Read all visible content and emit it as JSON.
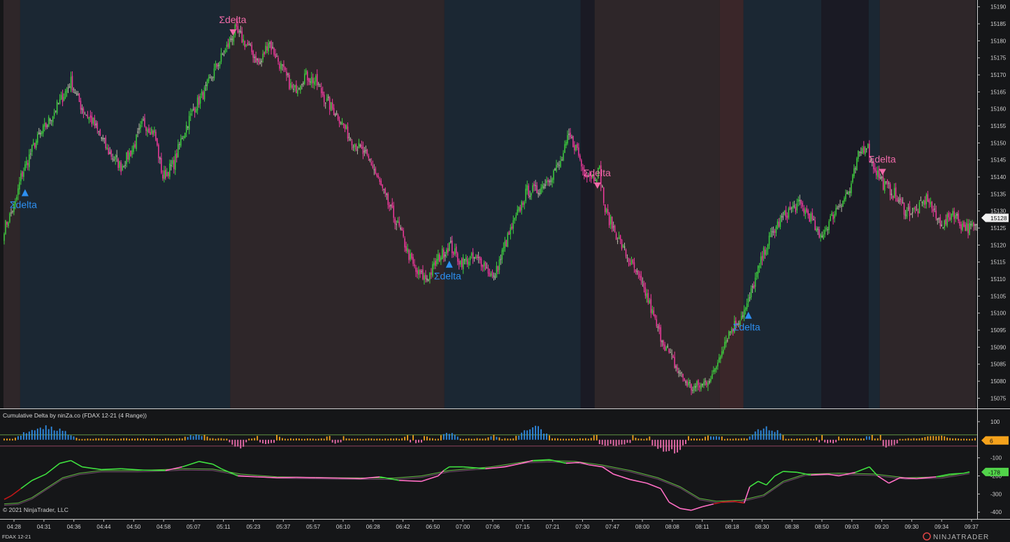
{
  "chart_data": [
    {
      "type": "candlestick",
      "panel": "price",
      "instrument": "FDAX 12-21",
      "ylim": [
        15072,
        15192
      ],
      "y_ticks": [
        15075,
        15080,
        15085,
        15090,
        15095,
        15100,
        15105,
        15110,
        15115,
        15120,
        15125,
        15130,
        15135,
        15140,
        15145,
        15150,
        15155,
        15160,
        15165,
        15170,
        15175,
        15180,
        15185,
        15190
      ],
      "last_price": "15128",
      "colors": {
        "up": "#3ecf3e",
        "down": "#ee3a9c",
        "neutral": "#b6b6a4"
      },
      "close_path": [
        [
          0,
          15125
        ],
        [
          8,
          15132
        ],
        [
          12,
          15140
        ],
        [
          22,
          15150
        ],
        [
          30,
          15155
        ],
        [
          40,
          15162
        ],
        [
          48,
          15168
        ],
        [
          56,
          15160
        ],
        [
          64,
          15156
        ],
        [
          74,
          15148
        ],
        [
          84,
          15143
        ],
        [
          92,
          15148
        ],
        [
          100,
          15156
        ],
        [
          108,
          15153
        ],
        [
          114,
          15140
        ],
        [
          122,
          15144
        ],
        [
          128,
          15152
        ],
        [
          136,
          15160
        ],
        [
          144,
          15165
        ],
        [
          152,
          15172
        ],
        [
          160,
          15178
        ],
        [
          166,
          15183
        ],
        [
          172,
          15180
        ],
        [
          176,
          15178
        ],
        [
          184,
          15173
        ],
        [
          190,
          15180
        ],
        [
          196,
          15175
        ],
        [
          202,
          15170
        ],
        [
          208,
          15165
        ],
        [
          216,
          15170
        ],
        [
          224,
          15168
        ],
        [
          232,
          15162
        ],
        [
          240,
          15158
        ],
        [
          248,
          15152
        ],
        [
          256,
          15148
        ],
        [
          264,
          15144
        ],
        [
          270,
          15138
        ],
        [
          276,
          15132
        ],
        [
          284,
          15125
        ],
        [
          290,
          15118
        ],
        [
          296,
          15112
        ],
        [
          304,
          15110
        ],
        [
          312,
          15116
        ],
        [
          320,
          15120
        ],
        [
          328,
          15115
        ],
        [
          336,
          15116
        ],
        [
          344,
          15115
        ],
        [
          352,
          15110
        ],
        [
          360,
          15120
        ],
        [
          368,
          15128
        ],
        [
          376,
          15136
        ],
        [
          384,
          15136
        ],
        [
          392,
          15140
        ],
        [
          400,
          15144
        ],
        [
          406,
          15152
        ],
        [
          412,
          15148
        ],
        [
          416,
          15142
        ],
        [
          424,
          15140
        ],
        [
          428,
          15142
        ],
        [
          432,
          15130
        ],
        [
          438,
          15125
        ],
        [
          446,
          15118
        ],
        [
          454,
          15112
        ],
        [
          462,
          15105
        ],
        [
          470,
          15095
        ],
        [
          478,
          15088
        ],
        [
          486,
          15082
        ],
        [
          494,
          15078
        ],
        [
          502,
          15079
        ],
        [
          510,
          15082
        ],
        [
          516,
          15090
        ],
        [
          522,
          15095
        ],
        [
          528,
          15098
        ],
        [
          534,
          15102
        ],
        [
          540,
          15110
        ],
        [
          548,
          15120
        ],
        [
          556,
          15126
        ],
        [
          564,
          15130
        ],
        [
          572,
          15132
        ],
        [
          580,
          15128
        ],
        [
          586,
          15122
        ],
        [
          592,
          15126
        ],
        [
          600,
          15132
        ],
        [
          608,
          15136
        ],
        [
          614,
          15146
        ],
        [
          620,
          15150
        ],
        [
          624,
          15144
        ],
        [
          632,
          15138
        ],
        [
          640,
          15135
        ],
        [
          648,
          15130
        ],
        [
          656,
          15130
        ],
        [
          664,
          15134
        ],
        [
          670,
          15128
        ],
        [
          676,
          15126
        ],
        [
          682,
          15130
        ],
        [
          688,
          15126
        ],
        [
          694,
          15125
        ]
      ],
      "regions": [
        {
          "from": 0,
          "to": 12,
          "tone": "bear"
        },
        {
          "from": 12,
          "to": 163,
          "tone": "bull"
        },
        {
          "from": 163,
          "to": 317,
          "tone": "bear"
        },
        {
          "from": 317,
          "to": 415,
          "tone": "bull"
        },
        {
          "from": 415,
          "to": 425,
          "tone": "dark"
        },
        {
          "from": 425,
          "to": 515,
          "tone": "bear"
        },
        {
          "from": 515,
          "to": 532,
          "tone": "bearlight"
        },
        {
          "from": 532,
          "to": 588,
          "tone": "bull"
        },
        {
          "from": 588,
          "to": 622,
          "tone": "dark"
        },
        {
          "from": 622,
          "to": 630,
          "tone": "bull"
        },
        {
          "from": 630,
          "to": 699,
          "tone": "bear"
        }
      ],
      "signals": [
        {
          "label": "Σdelta",
          "bar": 12,
          "dir": "up",
          "price": 15136
        },
        {
          "label": "Σdelta",
          "bar": 163,
          "dir": "down",
          "price": 15184
        },
        {
          "label": "Σdelta",
          "bar": 317,
          "dir": "up",
          "price": 15115
        },
        {
          "label": "Σdelta",
          "bar": 425,
          "dir": "down",
          "price": 15139
        },
        {
          "label": "Σdelta",
          "bar": 532,
          "dir": "up",
          "price": 15100
        },
        {
          "label": "Σdelta",
          "bar": 630,
          "dir": "down",
          "price": 15143
        }
      ],
      "x_labels": [
        "04:28",
        "04:31",
        "04:36",
        "04:44",
        "04:50",
        "04:58",
        "05:07",
        "05:11",
        "05:23",
        "05:37",
        "05:57",
        "06:10",
        "06:28",
        "06:42",
        "06:50",
        "07:00",
        "07:06",
        "07:15",
        "07:21",
        "07:30",
        "07:47",
        "08:00",
        "08:08",
        "08:11",
        "08:18",
        "08:30",
        "08:38",
        "08:50",
        "09:03",
        "09:20",
        "09:30",
        "09:34",
        "09:37"
      ]
    },
    {
      "type": "histogram+line",
      "panel": "indicator",
      "title": "Cumulative Delta by ninZa.co (FDAX 12-21 (4 Range))",
      "y_ticks": [
        100,
        -100,
        -200,
        -300,
        -400
      ],
      "ylim": [
        -430,
        150
      ],
      "current_histogram": "6",
      "current_line": "-178",
      "histogram_bursts": [
        {
          "center": 30,
          "width": 46,
          "peak": 145,
          "sign": 1
        },
        {
          "center": 138,
          "width": 20,
          "peak": 55,
          "sign": 1
        },
        {
          "center": 168,
          "width": 16,
          "peak": -95,
          "sign": -1
        },
        {
          "center": 190,
          "width": 22,
          "peak": -45,
          "sign": -1
        },
        {
          "center": 238,
          "width": 16,
          "peak": -40,
          "sign": -1
        },
        {
          "center": 296,
          "width": 22,
          "peak": -35,
          "sign": -1
        },
        {
          "center": 320,
          "width": 16,
          "peak": 70,
          "sign": 1
        },
        {
          "center": 352,
          "width": 10,
          "peak": 40,
          "sign": 1
        },
        {
          "center": 380,
          "width": 26,
          "peak": 145,
          "sign": 1
        },
        {
          "center": 438,
          "width": 34,
          "peak": -70,
          "sign": -1
        },
        {
          "center": 478,
          "width": 30,
          "peak": -160,
          "sign": -1
        },
        {
          "center": 510,
          "width": 16,
          "peak": 40,
          "sign": 1
        },
        {
          "center": 548,
          "width": 28,
          "peak": 135,
          "sign": 1
        },
        {
          "center": 592,
          "width": 20,
          "peak": -45,
          "sign": -1
        },
        {
          "center": 622,
          "width": 8,
          "peak": 45,
          "sign": 1
        },
        {
          "center": 636,
          "width": 16,
          "peak": -85,
          "sign": -1
        },
        {
          "center": 670,
          "width": 24,
          "peak": 25,
          "sign": 1
        }
      ],
      "delta_line": [
        [
          0,
          -330
        ],
        [
          5,
          -310
        ],
        [
          12,
          -270
        ],
        [
          20,
          -225
        ],
        [
          30,
          -190
        ],
        [
          40,
          -130
        ],
        [
          48,
          -115
        ],
        [
          56,
          -150
        ],
        [
          70,
          -165
        ],
        [
          84,
          -160
        ],
        [
          100,
          -168
        ],
        [
          116,
          -170
        ],
        [
          128,
          -150
        ],
        [
          140,
          -120
        ],
        [
          150,
          -135
        ],
        [
          156,
          -160
        ],
        [
          168,
          -200
        ],
        [
          182,
          -205
        ],
        [
          196,
          -210
        ],
        [
          210,
          -208
        ],
        [
          224,
          -210
        ],
        [
          240,
          -212
        ],
        [
          256,
          -215
        ],
        [
          270,
          -205
        ],
        [
          284,
          -225
        ],
        [
          300,
          -230
        ],
        [
          312,
          -200
        ],
        [
          316,
          -170
        ],
        [
          320,
          -150
        ],
        [
          330,
          -150
        ],
        [
          346,
          -160
        ],
        [
          360,
          -150
        ],
        [
          372,
          -130
        ],
        [
          380,
          -115
        ],
        [
          392,
          -110
        ],
        [
          404,
          -130
        ],
        [
          414,
          -125
        ],
        [
          420,
          -138
        ],
        [
          430,
          -150
        ],
        [
          438,
          -190
        ],
        [
          450,
          -220
        ],
        [
          462,
          -240
        ],
        [
          472,
          -270
        ],
        [
          478,
          -345
        ],
        [
          486,
          -380
        ],
        [
          494,
          -390
        ],
        [
          502,
          -370
        ],
        [
          510,
          -355
        ],
        [
          516,
          -345
        ],
        [
          524,
          -340
        ],
        [
          532,
          -350
        ],
        [
          536,
          -260
        ],
        [
          542,
          -230
        ],
        [
          548,
          -250
        ],
        [
          554,
          -200
        ],
        [
          560,
          -175
        ],
        [
          570,
          -180
        ],
        [
          580,
          -195
        ],
        [
          592,
          -190
        ],
        [
          600,
          -200
        ],
        [
          612,
          -180
        ],
        [
          622,
          -150
        ],
        [
          628,
          -200
        ],
        [
          636,
          -240
        ],
        [
          644,
          -210
        ],
        [
          656,
          -215
        ],
        [
          670,
          -205
        ],
        [
          680,
          -190
        ],
        [
          690,
          -185
        ],
        [
          694,
          -178
        ]
      ],
      "signal_line": [
        [
          0,
          -355
        ],
        [
          10,
          -350
        ],
        [
          20,
          -320
        ],
        [
          30,
          -270
        ],
        [
          42,
          -210
        ],
        [
          54,
          -185
        ],
        [
          70,
          -170
        ],
        [
          96,
          -170
        ],
        [
          130,
          -160
        ],
        [
          150,
          -162
        ],
        [
          170,
          -190
        ],
        [
          196,
          -205
        ],
        [
          240,
          -210
        ],
        [
          280,
          -212
        ],
        [
          300,
          -200
        ],
        [
          320,
          -170
        ],
        [
          350,
          -150
        ],
        [
          376,
          -120
        ],
        [
          392,
          -115
        ],
        [
          410,
          -120
        ],
        [
          430,
          -140
        ],
        [
          450,
          -170
        ],
        [
          470,
          -210
        ],
        [
          486,
          -260
        ],
        [
          500,
          -325
        ],
        [
          512,
          -340
        ],
        [
          530,
          -335
        ],
        [
          546,
          -305
        ],
        [
          560,
          -230
        ],
        [
          576,
          -190
        ],
        [
          600,
          -185
        ],
        [
          626,
          -190
        ],
        [
          648,
          -210
        ],
        [
          674,
          -205
        ],
        [
          694,
          -180
        ]
      ]
    }
  ],
  "footer": {
    "instrument": "FDAX 12-21",
    "copyright": "© 2021 NinjaTrader, LLC",
    "brand": "NINJATRADER"
  }
}
